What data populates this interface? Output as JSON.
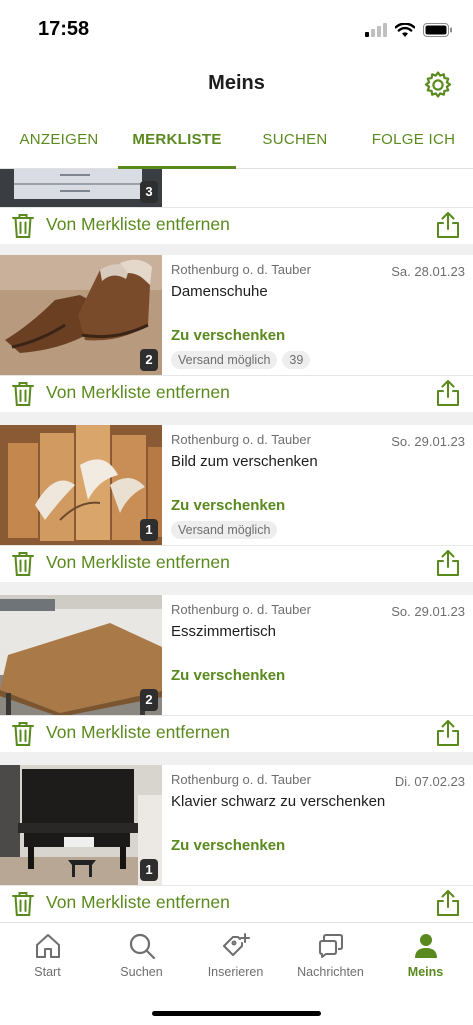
{
  "status": {
    "time": "17:58"
  },
  "header": {
    "title": "Meins"
  },
  "tabs": [
    {
      "label": "ANZEIGEN"
    },
    {
      "label": "MERKLISTE",
      "active": true
    },
    {
      "label": "SUCHEN"
    },
    {
      "label": "FOLGE ICH"
    }
  ],
  "actions": {
    "remove_label": "Von Merkliste entfernen"
  },
  "partial_top": {
    "image_count": "3"
  },
  "listings": [
    {
      "location": "Rothenburg o. d. Tauber",
      "date": "Sa. 28.01.23",
      "title": "Damenschuhe",
      "price": "Zu verschenken",
      "image_count": "2",
      "tags": [
        "Versand möglich",
        "39"
      ],
      "image": "brown-boots-photo"
    },
    {
      "location": "Rothenburg o. d. Tauber",
      "date": "So. 29.01.23",
      "title": "Bild zum verschenken",
      "price": "Zu verschenken",
      "image_count": "1",
      "tags": [
        "Versand möglich"
      ],
      "image": "calla-lily-canvas-photo"
    },
    {
      "location": "Rothenburg o. d. Tauber",
      "date": "So. 29.01.23",
      "title": "Esszimmertisch",
      "price": "Zu verschenken",
      "image_count": "2",
      "tags": [],
      "image": "wooden-table-photo"
    },
    {
      "location": "Rothenburg o. d. Tauber",
      "date": "Di. 07.02.23",
      "title": "Klavier schwarz zu verschenken",
      "price": "Zu verschenken",
      "image_count": "1",
      "tags": [],
      "image": "black-piano-photo"
    }
  ],
  "bottom_nav": [
    {
      "label": "Start",
      "icon": "home-icon"
    },
    {
      "label": "Suchen",
      "icon": "search-icon"
    },
    {
      "label": "Inserieren",
      "icon": "tag-plus-icon"
    },
    {
      "label": "Nachrichten",
      "icon": "chat-icon"
    },
    {
      "label": "Meins",
      "icon": "user-icon",
      "active": true
    }
  ],
  "colors": {
    "accent": "#5a8a1e",
    "muted": "#6e6e6e",
    "divider": "#e6e6e6"
  }
}
